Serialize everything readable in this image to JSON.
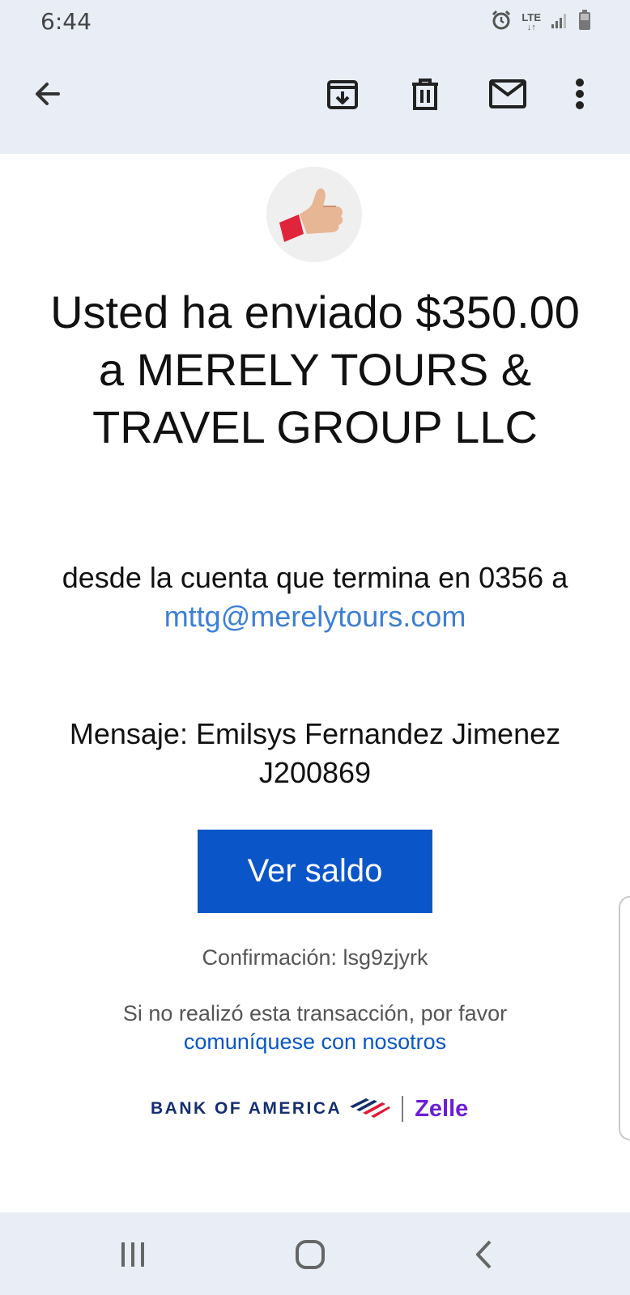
{
  "status_bar": {
    "time": "6:44",
    "network": "LTE"
  },
  "toolbar": {
    "back_icon": "arrow-left-icon",
    "archive_icon": "archive-icon",
    "delete_icon": "trash-icon",
    "mark_unread_icon": "mail-icon",
    "more_icon": "more-vertical-icon"
  },
  "email": {
    "avatar_icon": "thumbs-up-icon",
    "headline": "Usted ha enviado $350.00 a MERELY TOURS & TRAVEL GROUP LLC",
    "from_line": "desde la cuenta que termina en 0356 a",
    "recipient_email": "mttg@merelytours.com",
    "message": "Mensaje: Emilsys Fernandez Jimenez J200869",
    "cta_label": "Ver saldo",
    "confirmation": "Confirmación: lsg9zjyrk",
    "disclaimer": "Si no realizó esta transacción, por favor",
    "contact_link": "comuníquese con nosotros",
    "brand_boa": "BANK OF AMERICA",
    "brand_zelle": "Zelle",
    "colors": {
      "cta_background": "#0a56c8",
      "link": "#3d7fd6",
      "boa_navy": "#142f6e",
      "boa_red": "#e31837",
      "zelle_purple": "#6d1ed4"
    }
  },
  "nav_bar": {
    "recents_icon": "recents-icon",
    "home_icon": "home-icon",
    "back_icon": "back-chevron-icon"
  }
}
